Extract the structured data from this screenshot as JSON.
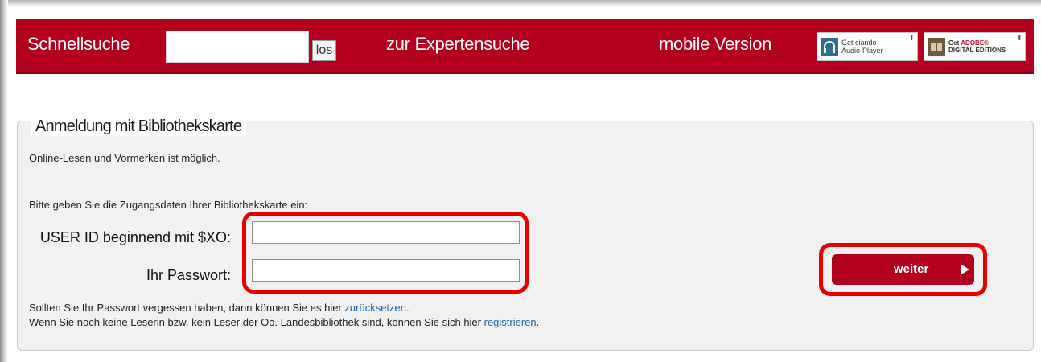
{
  "topbar": {
    "quick_search_label": "Schnellsuche",
    "search_value": "",
    "search_button": "los",
    "expert_search_link": "zur Expertensuche",
    "mobile_link": "mobile Version",
    "ciando_badge": {
      "line1": "Get ciando",
      "line2": "Audio-Player",
      "icon": "headphones-icon"
    },
    "adobe_badge": {
      "line1_prefix": "Get",
      "line1_brand": "ADOBE®",
      "line2": "DIGITAL EDITIONS",
      "icon": "book-icon"
    }
  },
  "login": {
    "legend": "Anmeldung mit Bibliothekskarte",
    "info": "Online-Lesen und Vormerken ist möglich.",
    "instruction": "Bitte geben Sie die Zugangsdaten Ihrer Bibliothekskarte ein:",
    "user_label": "USER ID beginnend mit $XO:",
    "user_value": "",
    "password_label": "Ihr Passwort:",
    "password_value": "",
    "submit_label": "weiter",
    "forgot_text": "Sollten Sie Ihr Passwort vergessen haben, dann können Sie es hier ",
    "forgot_link": "zurücksetzen",
    "forgot_end": ".",
    "register_text": "Wenn Sie noch keine Leserin bzw. kein Leser der Oö. Landesbibliothek sind, können Sie sich hier ",
    "register_link": "registrieren",
    "register_end": "."
  },
  "colors": {
    "brand_red": "#b3001f",
    "highlight_red": "#e60000",
    "link_blue": "#1f63a6",
    "panel_bg": "#f1f1f1"
  }
}
